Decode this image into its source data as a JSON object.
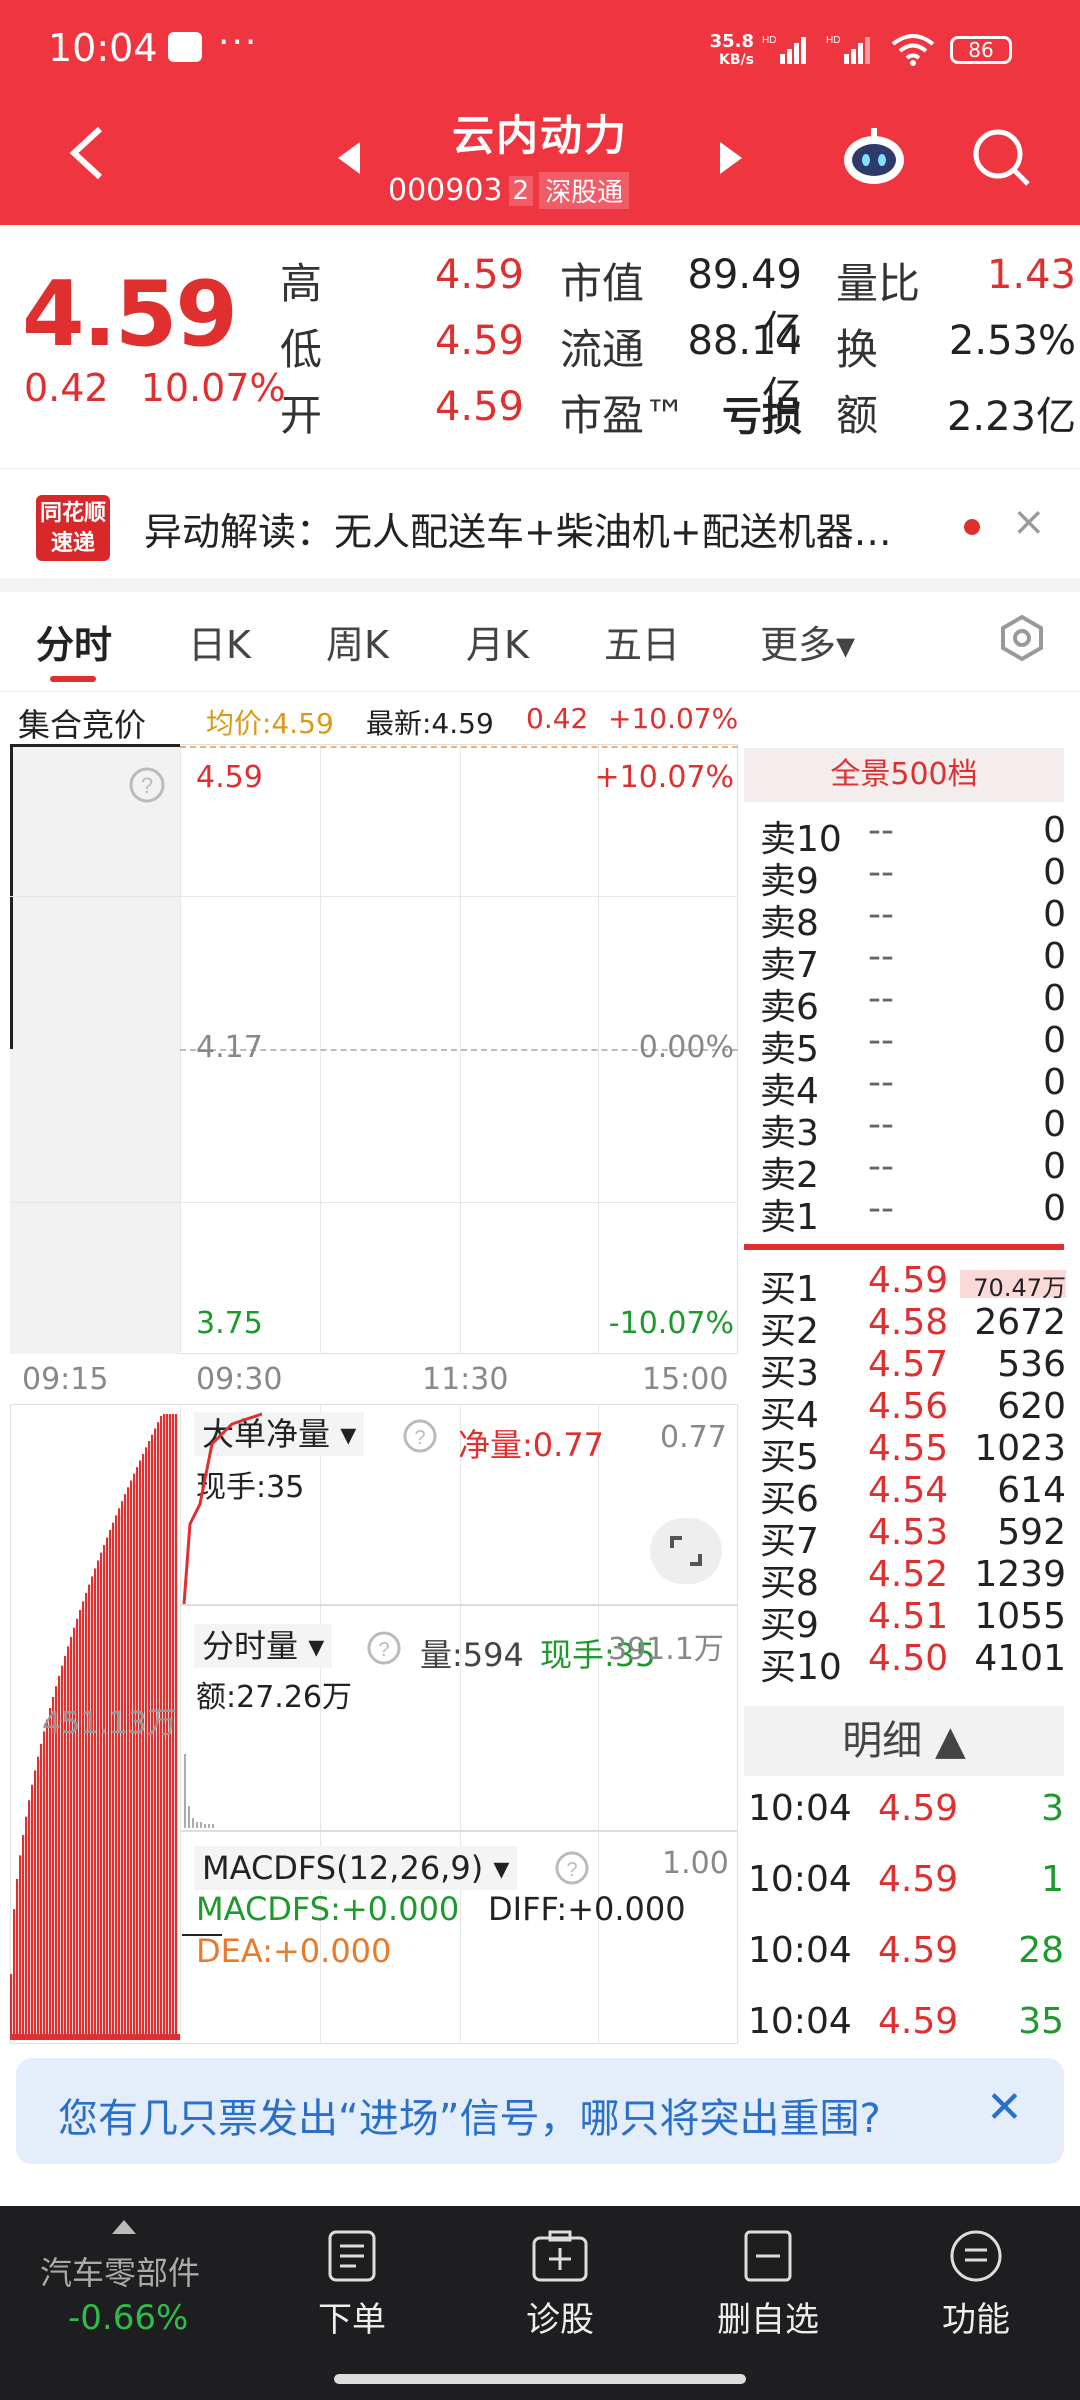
{
  "status": {
    "time": "10:04",
    "net_top": "35.8",
    "net_bottom": "KB/s",
    "hd1": "HD",
    "hd2": "HD",
    "battery": "86",
    "dots": "···"
  },
  "header": {
    "title": "云内动力",
    "code": "000903",
    "badge": "2",
    "market": "深股通"
  },
  "quote": {
    "price": "4.59",
    "change": "0.42",
    "change_pct": "10.07%",
    "high_label": "高",
    "high": "4.59",
    "low_label": "低",
    "low": "4.59",
    "open_label": "开",
    "open": "4.59",
    "mcap_label": "市值",
    "mcap": "89.49亿",
    "float_label": "流通",
    "float": "88.14亿",
    "pe_label": "市盈™",
    "pe": "亏损",
    "vr_label": "量比",
    "vr": "1.43",
    "turn_label": "换",
    "turn": "2.53%",
    "amt_label": "额",
    "amt": "2.23亿"
  },
  "news": {
    "logo_line1": "同花顺",
    "logo_line2": "速递",
    "text": "异动解读：无人配送车+柴油机+配送机器…",
    "close": "×"
  },
  "tabs": [
    "分时",
    "日K",
    "周K",
    "月K",
    "五日",
    "更多▾"
  ],
  "chart_header": {
    "auction": "集合竞价",
    "avg": "均价:4.59",
    "latest": "最新:4.59",
    "chg": "0.42",
    "chg_pct": "+10.07%"
  },
  "chart": {
    "top_price": "4.59",
    "top_pct": "+10.07%",
    "mid_price": "4.17",
    "mid_pct": "0.00%",
    "bot_price": "3.75",
    "bot_pct": "-10.07%",
    "t0": "09:15",
    "t1": "09:30",
    "t2": "11:30",
    "t3": "15:00",
    "auction_vol": "451.13万",
    "big_label": "大单净量",
    "big_net": "净量:0.77",
    "big_val": "0.77",
    "big_now": "现手:35",
    "vol_label": "分时量",
    "vol": "量:594",
    "vol_now": "现手:35",
    "vol_axis": "391.1万",
    "vol_amt": "额:27.26万",
    "macd_label": "MACDFS(12,26,9)",
    "macd_axis": "1.00",
    "macdfs": "MACDFS:+0.000",
    "diff": "DIFF:+0.000",
    "dea": "DEA:+0.000"
  },
  "orderbook": {
    "header": "全景500档",
    "asks": [
      {
        "label": "卖10",
        "price": "--",
        "vol": "0"
      },
      {
        "label": "卖9",
        "price": "--",
        "vol": "0"
      },
      {
        "label": "卖8",
        "price": "--",
        "vol": "0"
      },
      {
        "label": "卖7",
        "price": "--",
        "vol": "0"
      },
      {
        "label": "卖6",
        "price": "--",
        "vol": "0"
      },
      {
        "label": "卖5",
        "price": "--",
        "vol": "0"
      },
      {
        "label": "卖4",
        "price": "--",
        "vol": "0"
      },
      {
        "label": "卖3",
        "price": "--",
        "vol": "0"
      },
      {
        "label": "卖2",
        "price": "--",
        "vol": "0"
      },
      {
        "label": "卖1",
        "price": "--",
        "vol": "0"
      }
    ],
    "bids": [
      {
        "label": "买1",
        "price": "4.59",
        "vol": "70.47万"
      },
      {
        "label": "买2",
        "price": "4.58",
        "vol": "2672"
      },
      {
        "label": "买3",
        "price": "4.57",
        "vol": "536"
      },
      {
        "label": "买4",
        "price": "4.56",
        "vol": "620"
      },
      {
        "label": "买5",
        "price": "4.55",
        "vol": "1023"
      },
      {
        "label": "买6",
        "price": "4.54",
        "vol": "614"
      },
      {
        "label": "买7",
        "price": "4.53",
        "vol": "592"
      },
      {
        "label": "买8",
        "price": "4.52",
        "vol": "1239"
      },
      {
        "label": "买9",
        "price": "4.51",
        "vol": "1055"
      },
      {
        "label": "买10",
        "price": "4.50",
        "vol": "4101"
      }
    ],
    "detail_header": "明细 ▲",
    "details": [
      {
        "time": "10:04",
        "price": "4.59",
        "vol": "3"
      },
      {
        "time": "10:04",
        "price": "4.59",
        "vol": "1"
      },
      {
        "time": "10:04",
        "price": "4.59",
        "vol": "28"
      },
      {
        "time": "10:04",
        "price": "4.59",
        "vol": "35"
      }
    ]
  },
  "promo": {
    "text": "您有几只票发出“进场”信号，哪只将突出重围?",
    "close": "✕"
  },
  "bottom_nav": {
    "sector": "汽车零部件",
    "sector_chg": "-0.66%",
    "items": [
      "下单",
      "诊股",
      "删自选",
      "功能"
    ]
  },
  "colors": {
    "brand": "#ee3540",
    "up": "#e02f2f",
    "down": "#1e9a2c",
    "avg": "#d99a1a",
    "link": "#2a6fc9"
  }
}
